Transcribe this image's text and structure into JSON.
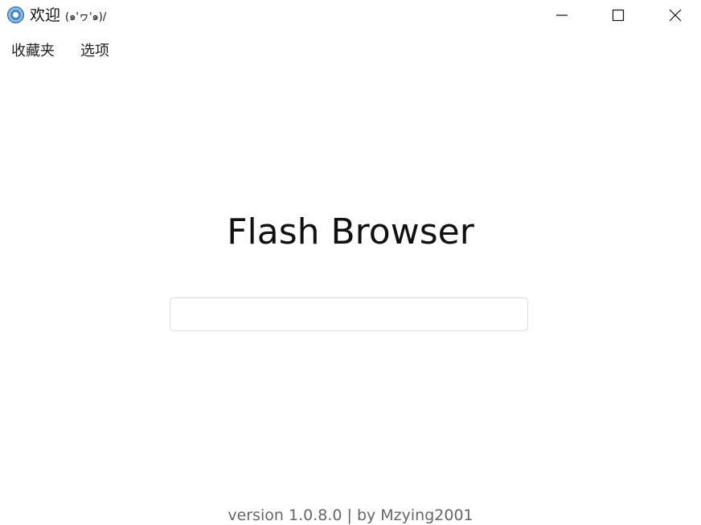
{
  "window": {
    "title_main": "欢迎 ",
    "title_kaomoji": "(๑'ヮ'๑)/",
    "icon": "browser-app-icon",
    "controls": {
      "minimize_icon": "minimize-icon",
      "maximize_icon": "maximize-icon",
      "close_icon": "close-icon"
    }
  },
  "menu": {
    "items": [
      {
        "label": "收藏夹"
      },
      {
        "label": "选项"
      }
    ]
  },
  "main": {
    "title": "Flash Browser",
    "search": {
      "value": "",
      "placeholder": ""
    }
  },
  "footer": {
    "text": "version 1.0.8.0 | by Mzying2001"
  }
}
